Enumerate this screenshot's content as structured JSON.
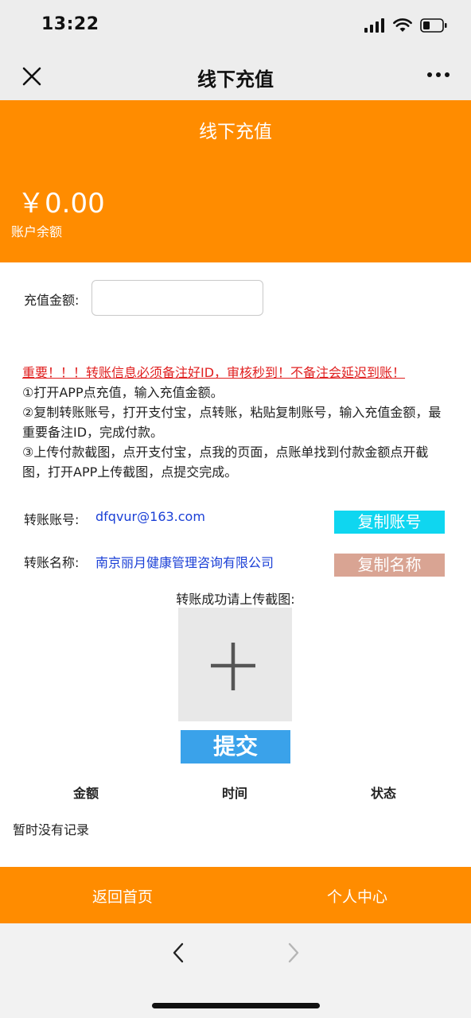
{
  "status_bar": {
    "time": "13:22"
  },
  "nav": {
    "title": "线下充值"
  },
  "hero": {
    "title": "线下充值",
    "balance": "￥0.00",
    "balance_label": "账户余额"
  },
  "recharge": {
    "amount_label": "充值金额:",
    "amount_value": "",
    "amount_placeholder": ""
  },
  "instructions": {
    "warning": "重要！！！转账信息必须备注好ID，审核秒到！不备注会延迟到账！",
    "step1": "①打开APP点充值，输入充值金额。",
    "step2": "②复制转账账号，打开支付宝，点转账，粘贴复制账号，输入充值金额，最重要备注ID，完成付款。",
    "step3": "③上传付款截图，点开支付宝，点我的页面，点账单找到付款金额点开截图，打开APP上传截图，点提交完成。"
  },
  "account": {
    "label": "转账账号:",
    "value": "dfqvur@163.com",
    "copy_label": "复制账号"
  },
  "account_name": {
    "label": "转账名称:",
    "value": "南京丽月健康管理咨询有限公司",
    "copy_label": "复制名称"
  },
  "upload": {
    "label": "转账成功请上传截图:"
  },
  "submit": {
    "label": "提交"
  },
  "records": {
    "columns": [
      "金额",
      "时间",
      "状态"
    ],
    "empty_text": "暂时没有记录"
  },
  "bottom_nav": {
    "home": "返回首页",
    "profile": "个人中心"
  },
  "colors": {
    "primary": "#ff8c00",
    "copy_account": "#0fd6f0",
    "copy_name": "#d9a493",
    "submit": "#3aa2ea",
    "link": "#1a3fd6",
    "warning": "#e02020"
  }
}
